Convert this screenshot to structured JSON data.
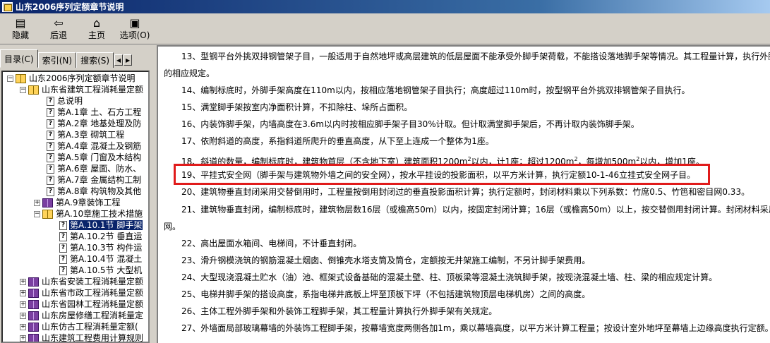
{
  "window": {
    "title": "山东2006序列定额章节说明"
  },
  "toolbar": {
    "buttons": [
      {
        "label": "隐藏",
        "icon": "hide-icon"
      },
      {
        "label": "后退",
        "icon": "back-arrow-icon"
      },
      {
        "label": "主页",
        "icon": "home-icon"
      },
      {
        "label": "选项(O)",
        "icon": "options-icon"
      }
    ]
  },
  "sidebar": {
    "tabs": [
      "目录(C)",
      "索引(N)",
      "搜索(S)"
    ],
    "tab_scroll": [
      "◀",
      "▶"
    ],
    "tree": [
      {
        "label": "山东2006序列定额章节说明"
      },
      {
        "label": "山东省建筑工程消耗量定额"
      },
      {
        "label": "总说明"
      },
      {
        "label": "第A.1章 土、石方工程"
      },
      {
        "label": "第A.2章 地基处理及防"
      },
      {
        "label": "第A.3章 砌筑工程"
      },
      {
        "label": "第A.4章 混凝土及钢筋"
      },
      {
        "label": "第A.5章 门窗及木结构"
      },
      {
        "label": "第A.6章 屋面、防水、"
      },
      {
        "label": "第A.7章 金属结构工制"
      },
      {
        "label": "第A.8章 构筑物及其他"
      },
      {
        "label": "第A.9章装饰工程"
      },
      {
        "label": "第A.10章施工技术措施"
      },
      {
        "label": "第A.10.1节 脚手架"
      },
      {
        "label": "第A.10.2节 垂直运"
      },
      {
        "label": "第A.10.3节 构件运"
      },
      {
        "label": "第A.10.4节 混凝土"
      },
      {
        "label": "第A.10.5节 大型机"
      },
      {
        "label": "山东省安装工程消耗量定额"
      },
      {
        "label": "山东省市政工程消耗量定额"
      },
      {
        "label": "山东省园林工程消耗量定额"
      },
      {
        "label": "山东房屋修缮工程消耗量定"
      },
      {
        "label": "山东仿古工程消耗量定额("
      },
      {
        "label": "山东建筑工程费用计算规则"
      }
    ]
  },
  "content": {
    "paragraphs": [
      "13、型钢平台外挑双排钢管架子目，一般适用于自然地坪或高层建筑的低层屋面不能承受外脚手架荷载，不能搭设落地脚手架等情况。其工程量计算，执行外脚",
      "的相应规定。",
      "14、编制标底时，外脚手架高度在110m以内，按相应落地钢管架子目执行；高度超过110m时，按型钢平台外挑双排钢管架子目执行。",
      "15、满堂脚手架按室内净面积计算，不扣除柱、垛所占面积。",
      "16、内装饰脚手架，内墙高度在3.6m以内时按相应脚手架子目30%计取。但计取满堂脚手架后，不再计取内装饰脚手架。",
      "17、依附斜道的高度，系指斜道所爬升的垂直高度，从下至上连成一个整体为1座。",
      "18、斜道的数量，编制标底时，建筑物首层（不含地下室）建筑面积1200m",
      "以内，计1座；超过1200m",
      "，每增加500m",
      "以内，增加1座。",
      "19、平挂式安全网（脚手架与建筑物外墙之间的安全网），按水平挂设的投影面积，以平方米计算，执行定额10-1-46立挂式安全网子目。",
      "20、建筑物垂直封闭采用交替倒用时，工程量按倒用封闭过的垂直投影面积计算；执行定额时，封闭材料乘以下列系数：竹席0.5、竹笆和密目网0.33。",
      "21、建筑物垂直封闭，编制标底时，建筑物层数16层（或檐高50m）以内，按固定封闭计算；16层（或檐高50m）以上，按交替倒用封闭计算。封闭材料采用密",
      "网。",
      "22、高出屋面水箱间、电梯间，不计垂直封闭。",
      "23、滑升钢模浇筑的钢筋混凝土烟囱、倒锥壳水塔支筒及筒仓，定额按无井架施工编制，不另计脚手架费用。",
      "24、大型现浇混凝土贮水（油）池、框架式设备基础的混凝土壁、柱、顶板梁等混凝土浇筑脚手架，按现浇混凝土墙、柱、梁的相应规定计算。",
      "25、电梯井脚手架的搭设高度，系指电梯井底板上坪至顶板下坪（不包括建筑物顶层电梯机房）之间的高度。",
      "26、主体工程外脚手架和外装饰工程脚手架，其工程量计算执行外脚手架有关规定。",
      "27、外墙面局部玻璃幕墙的外装饰工程脚手架，按幕墙宽度两侧各加1m，乘以幕墙高度，以平方米计算工程量；按设计室外地坪至幕墙上边缘高度执行定额。"
    ],
    "sup": "2"
  },
  "colors": {
    "highlight": "#e01b1b",
    "selection": "#0a246a",
    "titlebar": "#0a246a"
  }
}
